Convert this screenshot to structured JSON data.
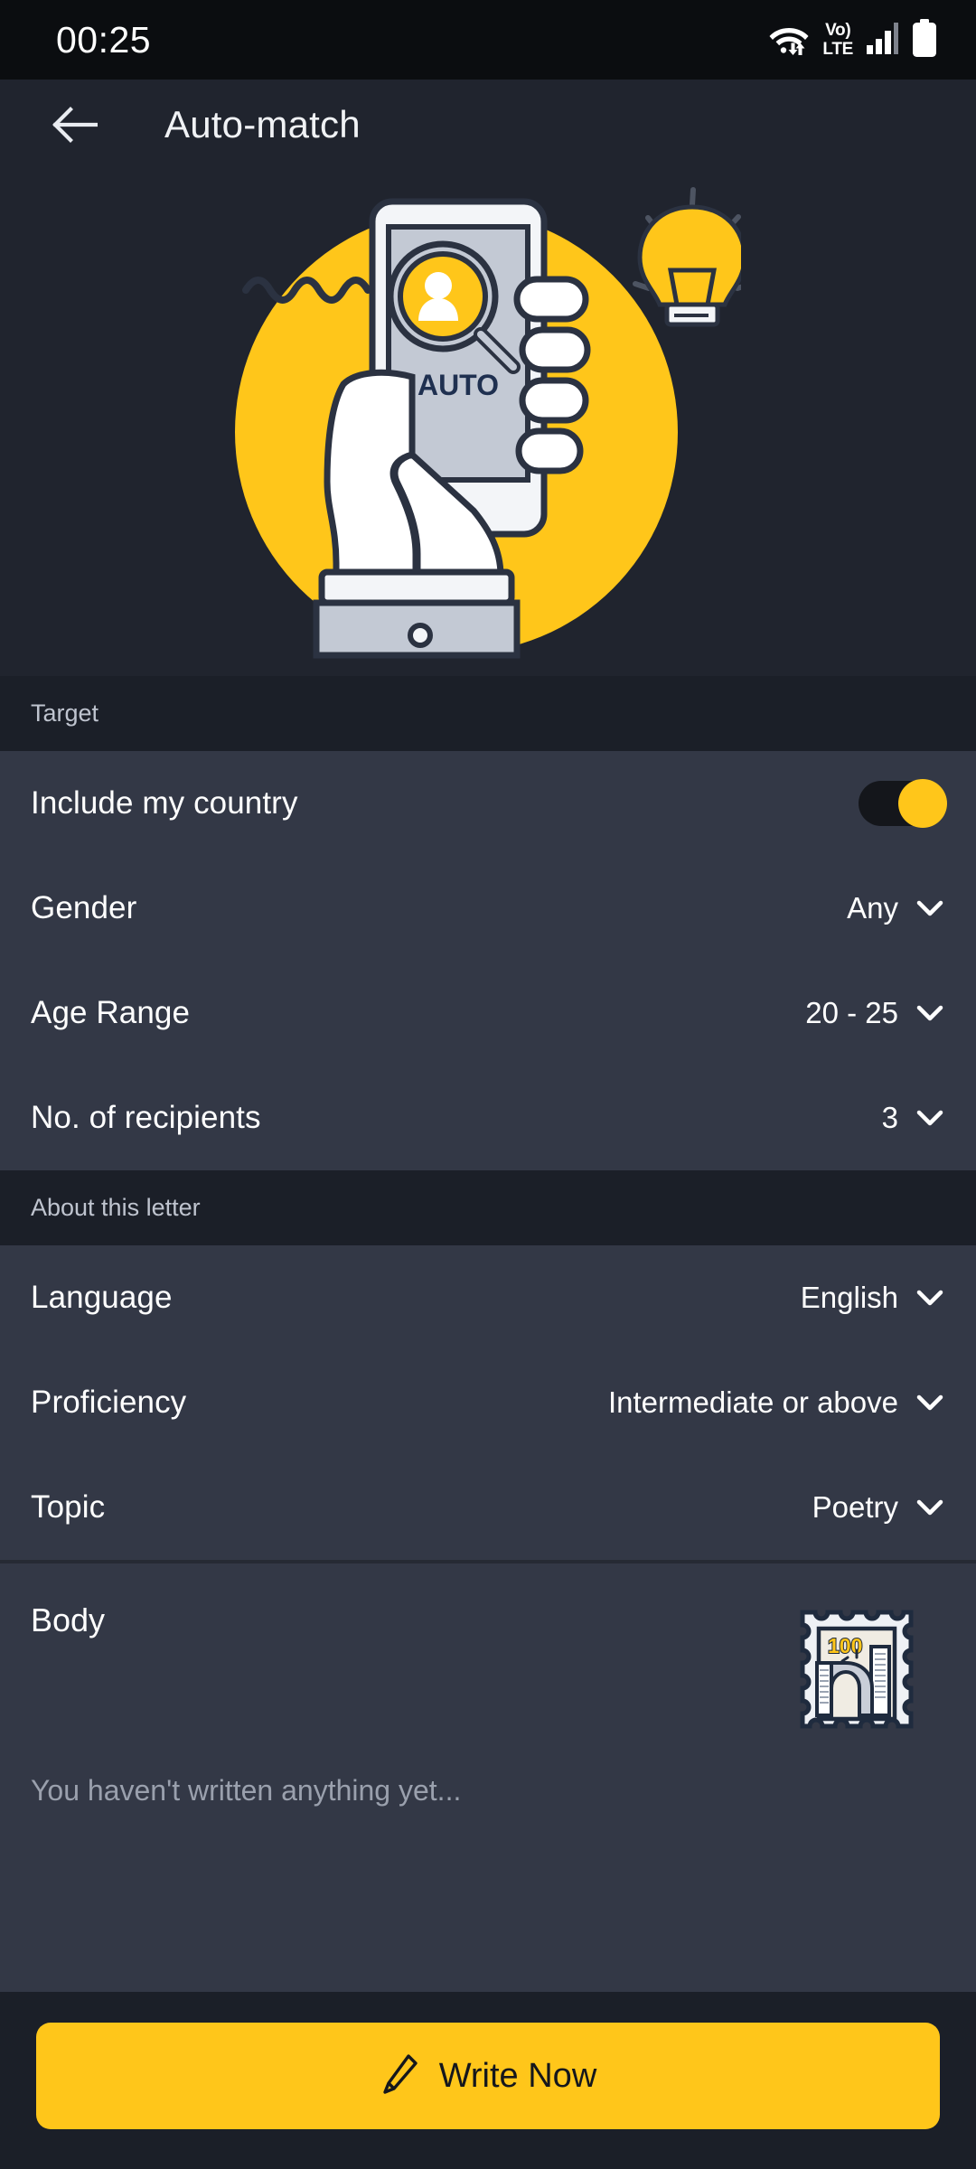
{
  "status_bar": {
    "clock": "00:25",
    "icons": {
      "wifi": "wifi-icon",
      "volte_line1": "Vo)",
      "volte_line2": "LTE",
      "signal": "signal-bars-icon",
      "battery": "battery-icon"
    }
  },
  "header": {
    "back_icon": "back-arrow-icon",
    "title": "Auto-match"
  },
  "hero": {
    "illustration_name": "auto-match-illustration",
    "phone_screen_text": "AUTO",
    "bulb_icon": "lightbulb-icon",
    "accent_color": "#ffc61a"
  },
  "sections": [
    {
      "title": "Target",
      "rows": [
        {
          "label": "Include my country",
          "type": "toggle",
          "value": "on"
        },
        {
          "label": "Gender",
          "type": "select",
          "value": "Any"
        },
        {
          "label": "Age Range",
          "type": "select",
          "value": "20 - 25"
        },
        {
          "label": "No. of recipients",
          "type": "select",
          "value": "3"
        }
      ]
    },
    {
      "title": "About this letter",
      "rows": [
        {
          "label": "Language",
          "type": "select",
          "value": "English"
        },
        {
          "label": "Proficiency",
          "type": "select",
          "value": "Intermediate or above"
        },
        {
          "label": "Topic",
          "type": "select",
          "value": "Poetry"
        }
      ]
    }
  ],
  "body_section": {
    "title": "Body",
    "placeholder": "You haven't written anything yet...",
    "stamp": {
      "icon_name": "postage-stamp-icon",
      "value": "100"
    }
  },
  "footer": {
    "write_button_label": "Write Now",
    "write_button_icon": "pencil-icon",
    "write_button_color": "#ffc61a"
  }
}
